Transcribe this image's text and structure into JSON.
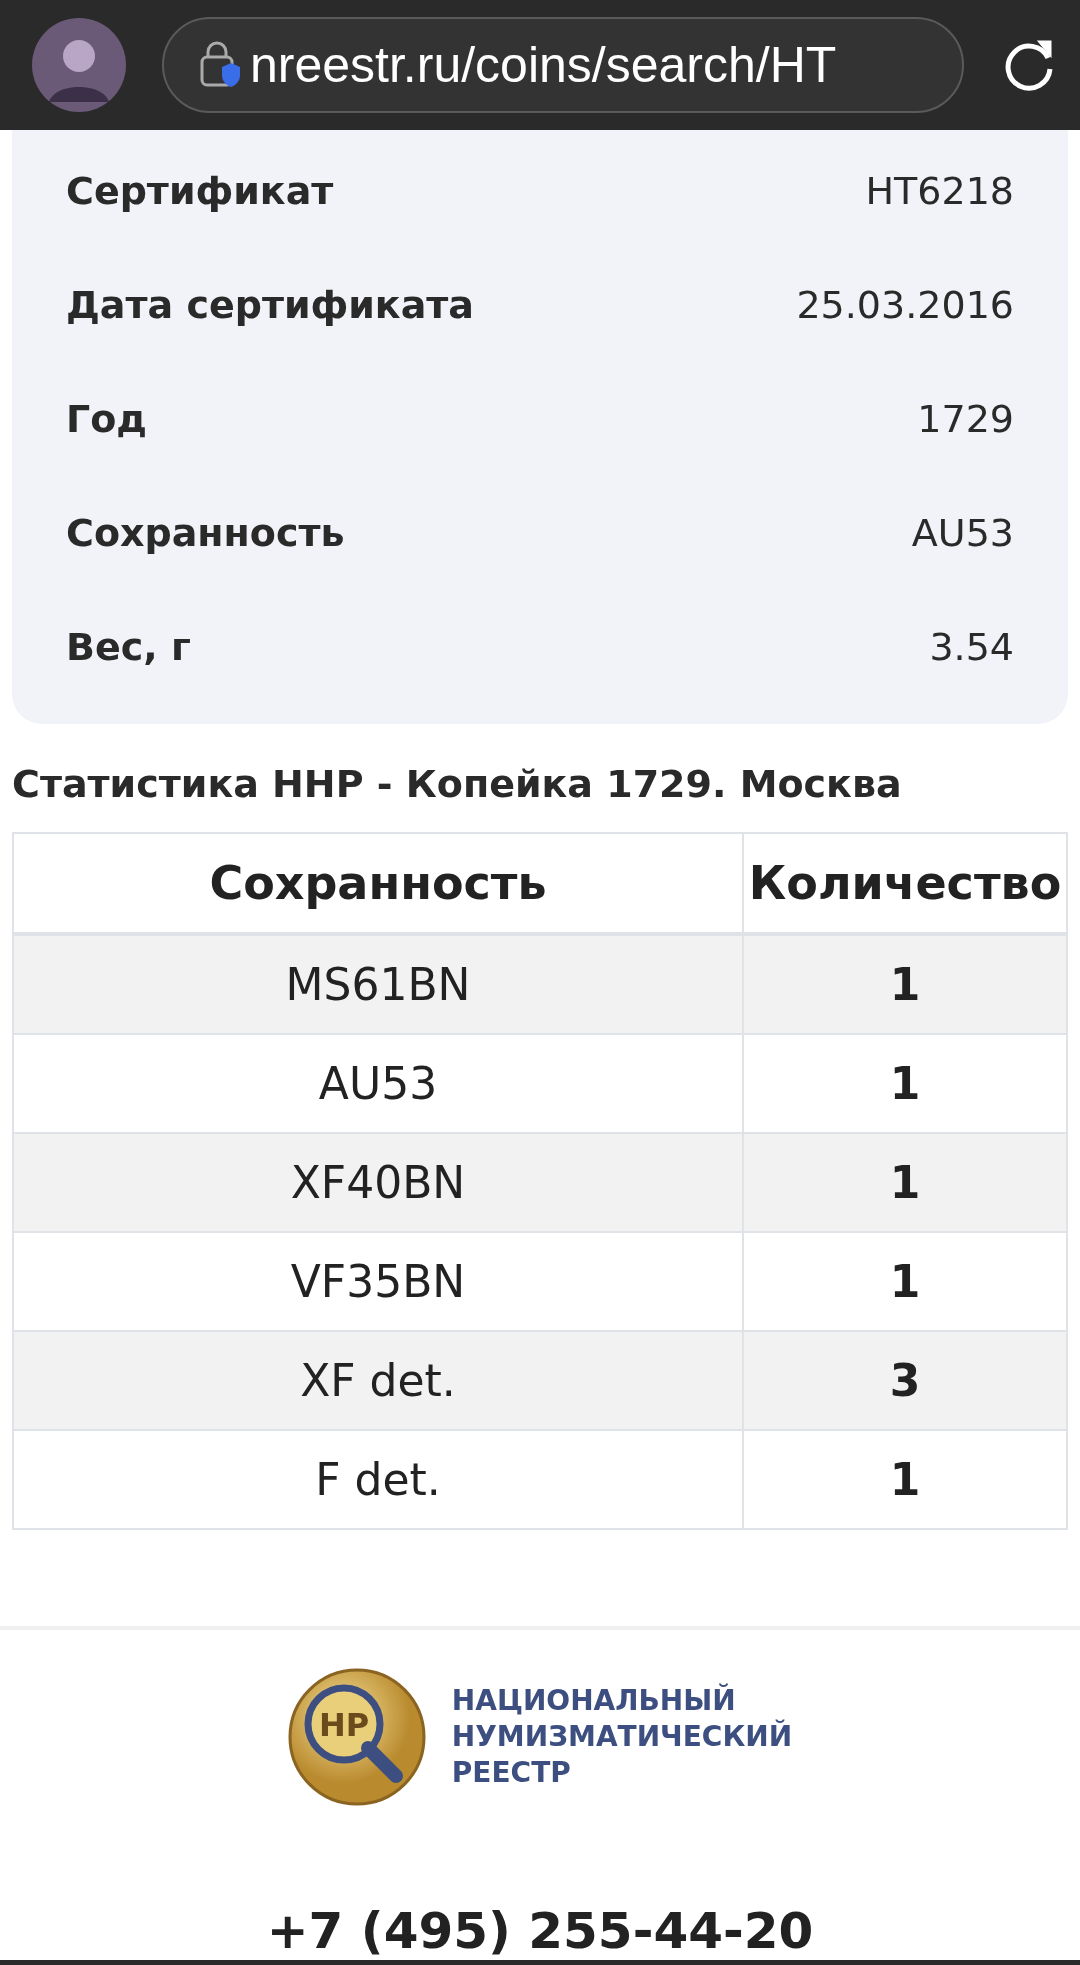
{
  "browser": {
    "url": "nreestr.ru/coins/search/HT"
  },
  "details": [
    {
      "label": "Сертификат",
      "value": "HT6218"
    },
    {
      "label": "Дата сертификата",
      "value": "25.03.2016"
    },
    {
      "label": "Год",
      "value": "1729"
    },
    {
      "label": "Сохранность",
      "value": "AU53"
    },
    {
      "label": "Вес, г",
      "value": "3.54"
    }
  ],
  "statistics": {
    "title": "Статистика ННР - Копейка 1729. Москва",
    "columns": [
      "Сохранность",
      "Количество"
    ],
    "rows": [
      [
        "MS61BN",
        "1"
      ],
      [
        "AU53",
        "1"
      ],
      [
        "XF40BN",
        "1"
      ],
      [
        "VF35BN",
        "1"
      ],
      [
        "XF det.",
        "3"
      ],
      [
        "F det.",
        "1"
      ]
    ]
  },
  "footer": {
    "logo_mark": "НР",
    "logo_lines": [
      "НАЦИОНАЛЬНЫЙ",
      "НУМИЗМАТИЧЕСКИЙ",
      "РЕЕСТР"
    ],
    "phone": "+7 (495) 255-44-20"
  }
}
